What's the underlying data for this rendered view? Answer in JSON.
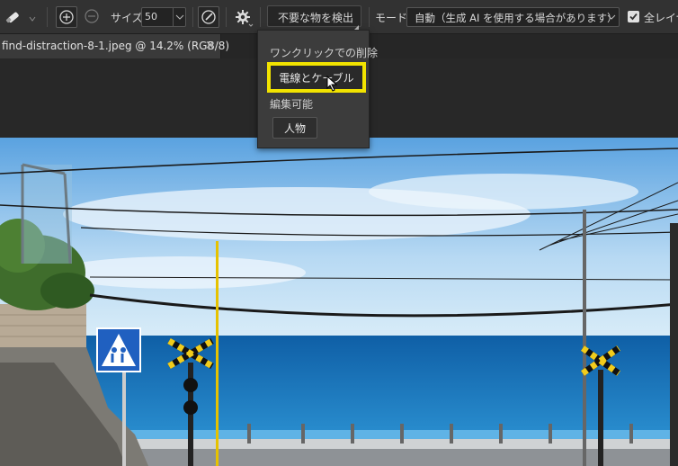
{
  "toolbar": {
    "size_label": "サイズ",
    "size_value": "50",
    "detect_button": "不要な物を検出",
    "mode_label": "モード",
    "mode_value": "自動（生成 AI を使用する場合があります）",
    "all_layers_label": "全レイヤ"
  },
  "document_tab": {
    "title": "find-distraction-8-1.jpeg @ 14.2% (RGB/8)",
    "close": "×"
  },
  "dropdown": {
    "one_click_header": "ワンクリックでの削除",
    "wires_button": "電線とケーブル",
    "editable_header": "編集可能",
    "people_button": "人物"
  },
  "icons": {
    "tool": "remove-tool-icon",
    "add": "add-circle-icon",
    "subtract": "subtract-circle-icon",
    "sample": "sample-brush-icon",
    "settings": "gear-icon",
    "checkbox": "checkbox-checked-icon"
  },
  "colors": {
    "highlight": "#f2e300",
    "panel": "#323232"
  }
}
